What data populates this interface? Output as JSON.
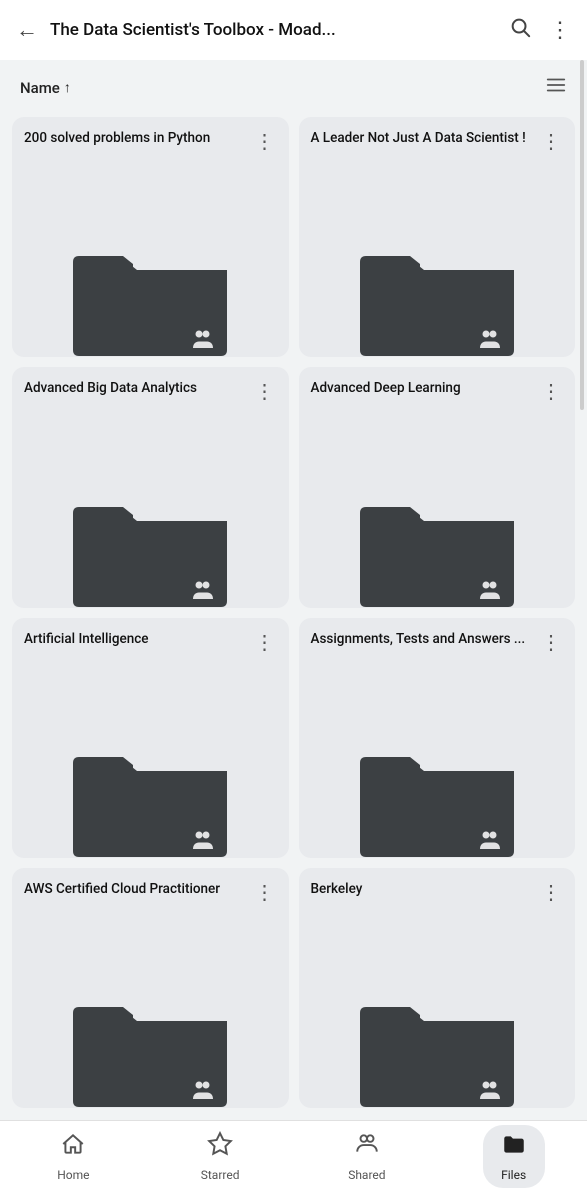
{
  "header": {
    "back_label": "←",
    "title": "The Data Scientist's Toolbox - Moad...",
    "search_icon": "🔍",
    "menu_icon": "⋮"
  },
  "sort": {
    "label": "Name",
    "arrow": "↑",
    "list_view_icon": "☰"
  },
  "folders": [
    {
      "id": 1,
      "title": "200 solved problems in Python"
    },
    {
      "id": 2,
      "title": "A Leader Not Just A Data Scientist !"
    },
    {
      "id": 3,
      "title": "Advanced Big Data Analytics"
    },
    {
      "id": 4,
      "title": "Advanced Deep Learning"
    },
    {
      "id": 5,
      "title": "Artificial Intelligence"
    },
    {
      "id": 6,
      "title": "Assignments, Tests and Answers ..."
    },
    {
      "id": 7,
      "title": "AWS  Certified Cloud Practitioner"
    },
    {
      "id": 8,
      "title": "Berkeley"
    }
  ],
  "bottom_nav": [
    {
      "id": "home",
      "label": "Home",
      "icon": "home",
      "active": false
    },
    {
      "id": "starred",
      "label": "Starred",
      "icon": "star",
      "active": false
    },
    {
      "id": "shared",
      "label": "Shared",
      "icon": "shared",
      "active": false
    },
    {
      "id": "files",
      "label": "Files",
      "icon": "folder",
      "active": true
    }
  ]
}
